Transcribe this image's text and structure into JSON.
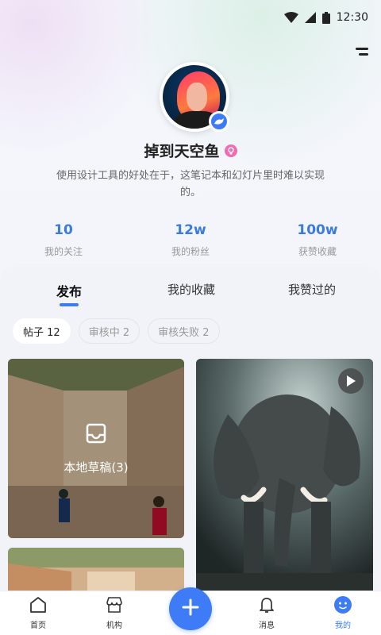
{
  "status_bar": {
    "time": "12:30"
  },
  "profile": {
    "username": "掉到天空鱼",
    "bio": "使用设计工具的好处在于，这笔记本和幻灯片里时难以实现的。"
  },
  "stats": [
    {
      "value": "10",
      "label": "我的关注"
    },
    {
      "value": "12w",
      "label": "我的粉丝"
    },
    {
      "value": "100w",
      "label": "获赞收藏"
    }
  ],
  "tabs": [
    {
      "label": "发布",
      "active": true
    },
    {
      "label": "我的收藏",
      "active": false
    },
    {
      "label": "我赞过的",
      "active": false
    }
  ],
  "chips": [
    {
      "label": "帖子 12",
      "active": true
    },
    {
      "label": "审核中 2",
      "active": false
    },
    {
      "label": "审核失败 2",
      "active": false
    }
  ],
  "cards": {
    "draft_label": "本地草稿(3)"
  },
  "bottom_nav": [
    {
      "label": "首页",
      "icon": "home-icon"
    },
    {
      "label": "机构",
      "icon": "store-icon"
    },
    {
      "label": "消息",
      "icon": "bell-icon"
    },
    {
      "label": "我的",
      "icon": "smiley-icon",
      "active": true
    }
  ],
  "colors": {
    "accent": "#3d7cf6",
    "stat": "#3a7be0",
    "gender": "#f06bb0"
  }
}
